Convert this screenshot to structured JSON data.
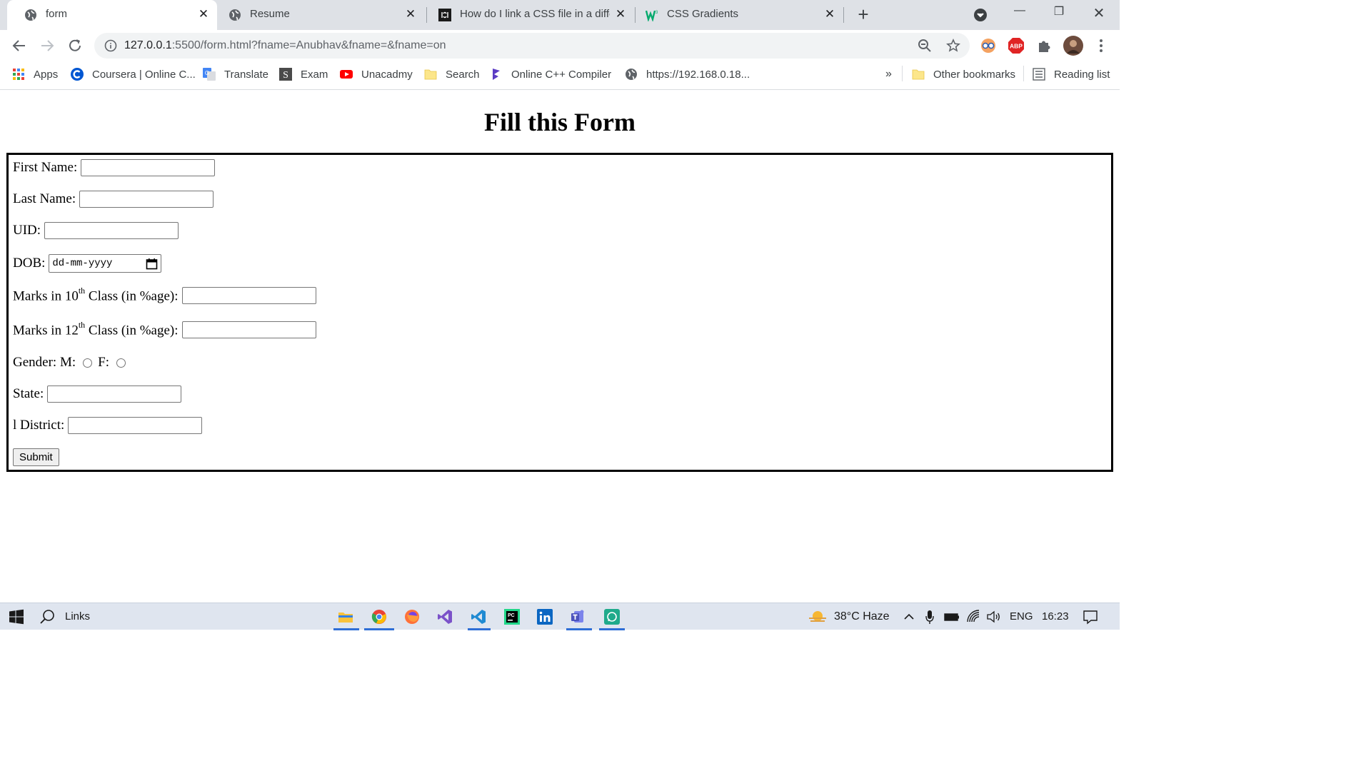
{
  "tabs": [
    {
      "title": "form",
      "icon": "globe-icon",
      "active": true
    },
    {
      "title": "Resume",
      "icon": "globe-icon",
      "active": false
    },
    {
      "title": "How do I link a CSS file in a differ",
      "icon": "geeks-icon",
      "active": false
    },
    {
      "title": "CSS Gradients",
      "icon": "w3schools-icon",
      "active": false
    }
  ],
  "toolbar": {
    "url_host": "127.0.0.1",
    "url_rest": ":5500/form.html?fname=Anubhav&fname=&fname=on"
  },
  "bookmarks": [
    {
      "label": "Apps",
      "icon": "apps-grid-icon"
    },
    {
      "label": "Coursera | Online C...",
      "icon": "coursera-icon"
    },
    {
      "label": "Translate",
      "icon": "translate-icon"
    },
    {
      "label": "Exam",
      "icon": "exam-icon"
    },
    {
      "label": "Unacadmy",
      "icon": "youtube-icon"
    },
    {
      "label": "Search",
      "icon": "folder-icon"
    },
    {
      "label": "Online C++ Compiler",
      "icon": "compiler-icon"
    },
    {
      "label": "https://192.168.0.18...",
      "icon": "globe-icon"
    }
  ],
  "bookmarks_more": "»",
  "other_bookmarks": "Other bookmarks",
  "reading_list": "Reading list",
  "page": {
    "heading": "Fill this Form",
    "fields": {
      "first_name": "First Name:",
      "last_name": "Last Name:",
      "uid": "UID:",
      "dob": "DOB:",
      "dob_placeholder": "dd-mm-yyyy",
      "marks10_pre": "Marks in 10",
      "marks10_sup": "th",
      "marks10_post": " Class (in %age):",
      "marks12_pre": "Marks in 12",
      "marks12_sup": "th",
      "marks12_post": " Class (in %age):",
      "gender": "Gender: M:",
      "gender_f": "F:",
      "state": "State:",
      "district": "l District:"
    },
    "submit": "Submit"
  },
  "taskbar": {
    "search_label": "Links",
    "weather": "38°C  Haze",
    "language": "ENG",
    "time": "16:23"
  },
  "colors": {
    "tabstrip_bg": "#dee1e6",
    "taskbar_bg": "#dfe5ef",
    "accent_blue": "#2f6ed6"
  }
}
